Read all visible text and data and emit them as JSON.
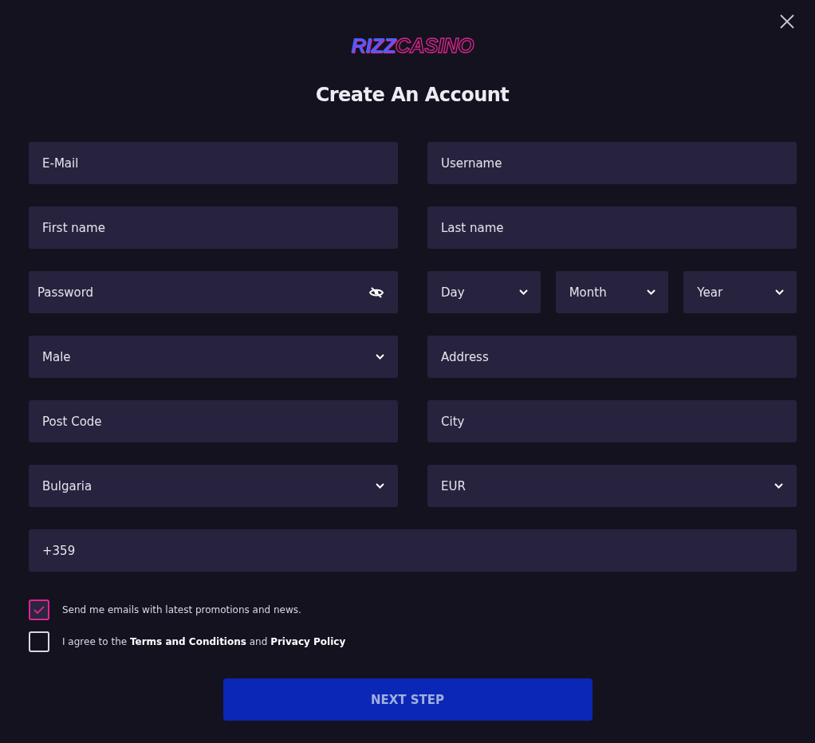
{
  "logo": {
    "part_1": "RIZZ",
    "part_2": "CASINO"
  },
  "title": "Create An Account",
  "rows": [
    {
      "fields": [
        {
          "kind": "input",
          "placeholder": "E-Mail"
        },
        {
          "kind": "input",
          "placeholder": "Username"
        }
      ]
    },
    {
      "fields": [
        {
          "kind": "input",
          "placeholder": "First name"
        },
        {
          "kind": "input",
          "placeholder": "Last name"
        }
      ]
    },
    {
      "fields": [
        {
          "kind": "password",
          "placeholder": "Password"
        },
        {
          "kind": "date",
          "parts": [
            {
              "value": "Day"
            },
            {
              "value": "Month"
            },
            {
              "value": "Year"
            }
          ]
        }
      ]
    },
    {
      "fields": [
        {
          "kind": "select",
          "value": "Male"
        },
        {
          "kind": "input",
          "placeholder": "Address"
        }
      ]
    },
    {
      "fields": [
        {
          "kind": "input",
          "placeholder": "Post Code"
        },
        {
          "kind": "input",
          "placeholder": "City"
        }
      ]
    },
    {
      "fields": [
        {
          "kind": "select",
          "value": "Bulgaria"
        },
        {
          "kind": "select",
          "value": "EUR"
        }
      ]
    },
    {
      "fields": [
        {
          "kind": "phone",
          "value": "+359"
        }
      ]
    }
  ],
  "consents": [
    {
      "checked": true,
      "parts": [
        {
          "kind": "text",
          "text": "Send me emails with latest promotions and news."
        }
      ]
    },
    {
      "checked": false,
      "parts": [
        {
          "kind": "text",
          "text": "I agree to the "
        },
        {
          "kind": "link",
          "text": "Terms and Conditions"
        },
        {
          "kind": "text",
          "text": " and "
        },
        {
          "kind": "link",
          "text": "Privacy Policy"
        }
      ]
    }
  ],
  "submit": "NEXT STEP"
}
